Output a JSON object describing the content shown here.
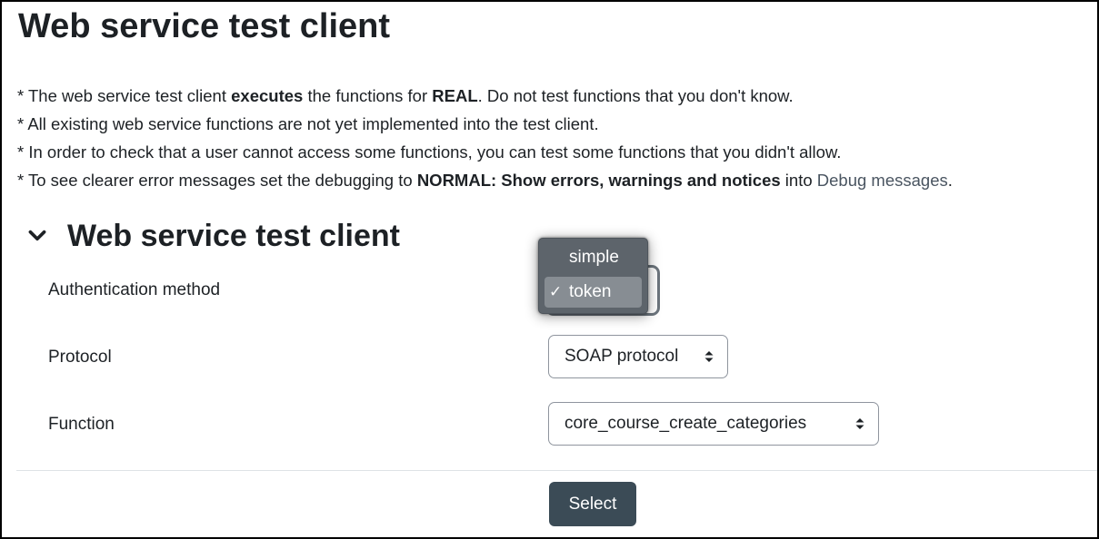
{
  "page": {
    "title": "Web service test client",
    "notes": [
      {
        "pre": "* The web service test client ",
        "bold": "executes",
        "mid": " the functions for ",
        "bold2": "REAL",
        "post": ". Do not test functions that you don't know."
      },
      {
        "text": "* All existing web service functions are not yet implemented into the test client."
      },
      {
        "text": "* In order to check that a user cannot access some functions, you can test some functions that you didn't allow."
      },
      {
        "pre": "* To see clearer error messages set the debugging to ",
        "bold": "NORMAL: Show errors, warnings and notices",
        "mid": " into ",
        "link": "Debug messages",
        "post": "."
      }
    ]
  },
  "form": {
    "section_title": "Web service test client",
    "auth": {
      "label": "Authentication method",
      "options": [
        "simple",
        "token"
      ],
      "selected": "token",
      "check_mark": "✓"
    },
    "protocol": {
      "label": "Protocol",
      "value": "SOAP protocol"
    },
    "function": {
      "label": "Function",
      "value": "core_course_create_categories"
    },
    "submit_label": "Select"
  },
  "icons": {
    "section_toggle": "chevron-down-icon",
    "select_caret": "up-down-caret-icon",
    "check": "check-icon"
  },
  "colors": {
    "button_bg": "#3b4b56",
    "link": "#4a5561",
    "popup_bg": "#5d646b",
    "popup_selected": "#878d93"
  }
}
